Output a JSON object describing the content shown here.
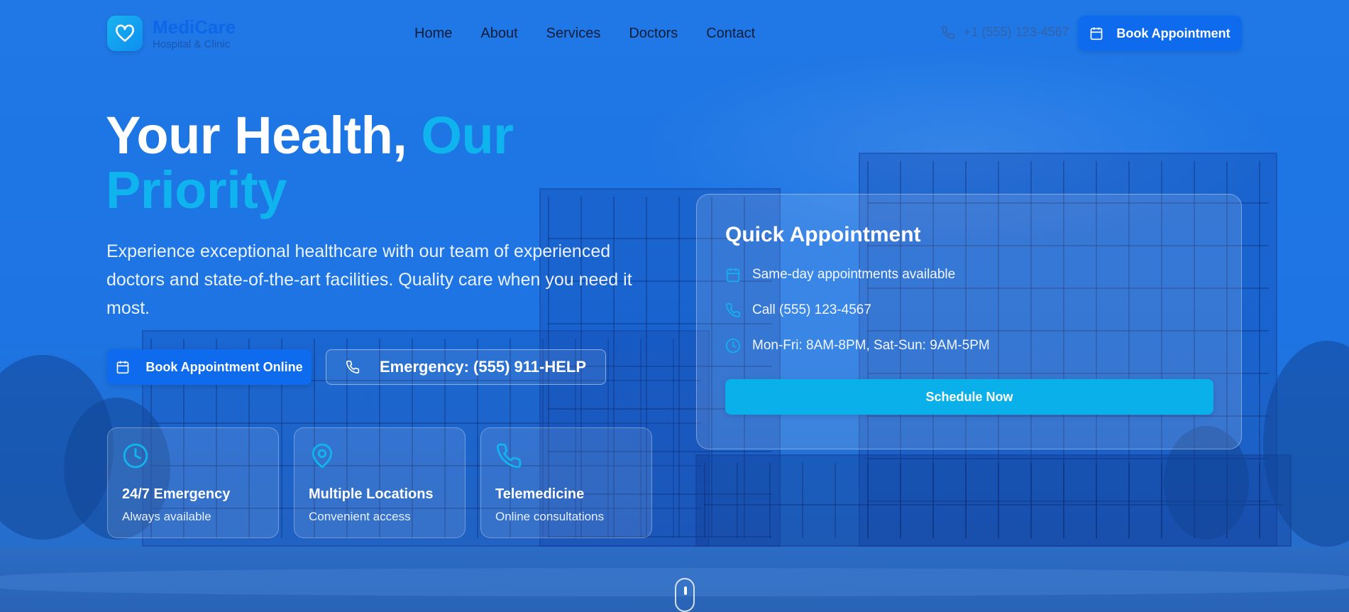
{
  "brand": {
    "name": "MediCare",
    "tagline": "Hospital & Clinic",
    "logo_icon": "heart-icon"
  },
  "nav": {
    "items": [
      {
        "label": "Home"
      },
      {
        "label": "About"
      },
      {
        "label": "Services"
      },
      {
        "label": "Doctors"
      },
      {
        "label": "Contact"
      }
    ]
  },
  "header": {
    "phone": "+1 (555) 123-4567",
    "book_label": "Book Appointment"
  },
  "hero": {
    "title_main": "Your Health, ",
    "title_accent": "Our Priority",
    "description": "Experience exceptional healthcare with our team of experienced doctors and state-of-the-art facilities. Quality care when you need it most.",
    "primary_cta": "Book Appointment Online",
    "emergency_cta": "Emergency: (555) 911-HELP"
  },
  "features": [
    {
      "icon": "clock-icon",
      "title": "24/7 Emergency",
      "subtitle": "Always available"
    },
    {
      "icon": "map-pin-icon",
      "title": "Multiple Locations",
      "subtitle": "Convenient access"
    },
    {
      "icon": "phone-icon",
      "title": "Telemedicine",
      "subtitle": "Online consultations"
    }
  ],
  "quick_appointment": {
    "title": "Quick Appointment",
    "rows": [
      {
        "icon": "calendar-icon",
        "text": "Same-day appointments available"
      },
      {
        "icon": "phone-icon",
        "text": "Call (555) 123-4567"
      },
      {
        "icon": "clock-icon",
        "text": "Mon-Fri: 8AM-8PM, Sat-Sun: 9AM-5PM"
      }
    ],
    "button": "Schedule Now"
  },
  "colors": {
    "primary": "#0e6bee",
    "accent": "#0fb3ee",
    "background": "#1c72e0"
  }
}
